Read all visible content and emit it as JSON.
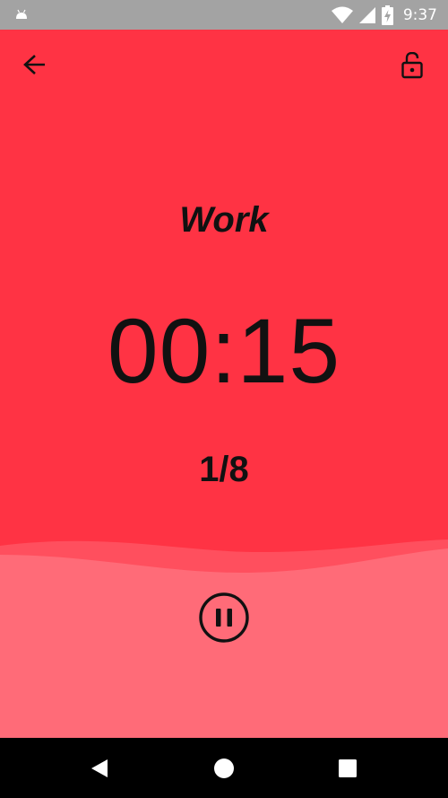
{
  "status_bar": {
    "time": "9:37",
    "icons": [
      "android-icon",
      "wifi-icon",
      "cell-signal-icon",
      "battery-charging-icon"
    ]
  },
  "toolbar": {
    "back_icon": "arrow-left-icon",
    "lock_icon": "unlock-icon"
  },
  "timer": {
    "phase": "Work",
    "time": "00:15",
    "round": "1/8"
  },
  "controls": {
    "pause_icon": "pause-circle-icon"
  },
  "nav_bar": {
    "icons": [
      "nav-back-icon",
      "nav-home-icon",
      "nav-recents-icon"
    ]
  },
  "colors": {
    "background": "#ff3344",
    "wave_light": "#ff6b78",
    "wave_mid": "#ff4f5e",
    "status_bar": "#a3a3a3",
    "nav_bar": "#000000",
    "text": "#111111"
  }
}
